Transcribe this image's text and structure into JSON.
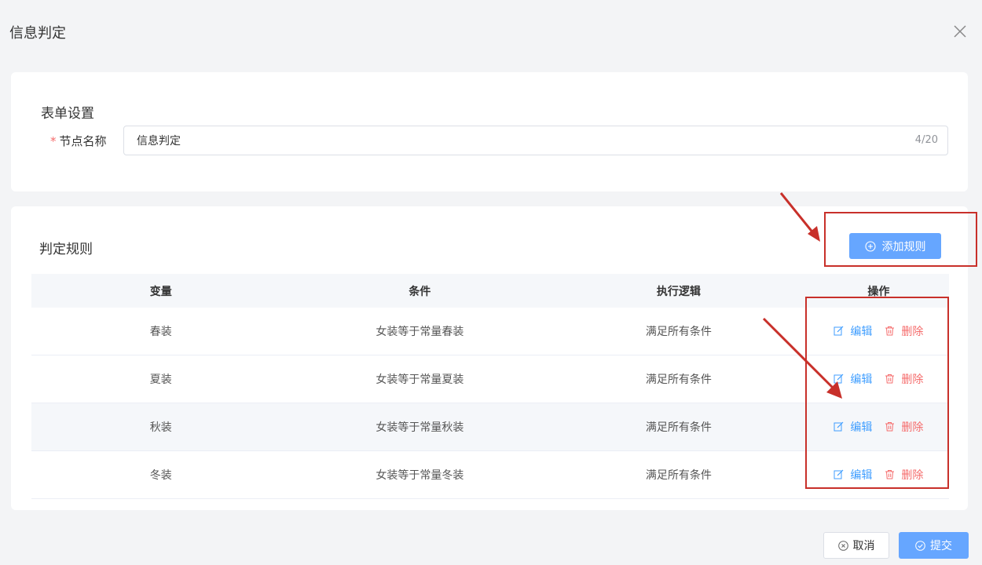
{
  "dialog": {
    "title": "信息判定"
  },
  "form": {
    "section_title": "表单设置",
    "required_mark": "*",
    "name_label": "节点名称",
    "name_value": "信息判定",
    "name_count": "4/20"
  },
  "rules": {
    "section_title": "判定规则",
    "add_label": "添加规则",
    "columns": [
      "变量",
      "条件",
      "执行逻辑",
      "操作"
    ],
    "rows": [
      {
        "variable": "春装",
        "condition": "女装等于常量春装",
        "logic": "满足所有条件",
        "edit": "编辑",
        "delete": "删除"
      },
      {
        "variable": "夏装",
        "condition": "女装等于常量夏装",
        "logic": "满足所有条件",
        "edit": "编辑",
        "delete": "删除"
      },
      {
        "variable": "秋装",
        "condition": "女装等于常量秋装",
        "logic": "满足所有条件",
        "edit": "编辑",
        "delete": "删除"
      },
      {
        "variable": "冬装",
        "condition": "女装等于常量冬装",
        "logic": "满足所有条件",
        "edit": "编辑",
        "delete": "删除"
      }
    ]
  },
  "footer": {
    "cancel_label": "取消",
    "submit_label": "提交"
  },
  "icons": {
    "close": "close-icon",
    "add": "plus-circle-icon",
    "edit": "edit-icon",
    "delete": "trash-icon",
    "cancel": "close-circle-icon",
    "submit": "check-circle-icon"
  },
  "colors": {
    "primary": "#409eff",
    "primary_button": "#66a6ff",
    "danger": "#f56c6c",
    "annotation": "#c8302a",
    "background": "#f3f4f6"
  }
}
